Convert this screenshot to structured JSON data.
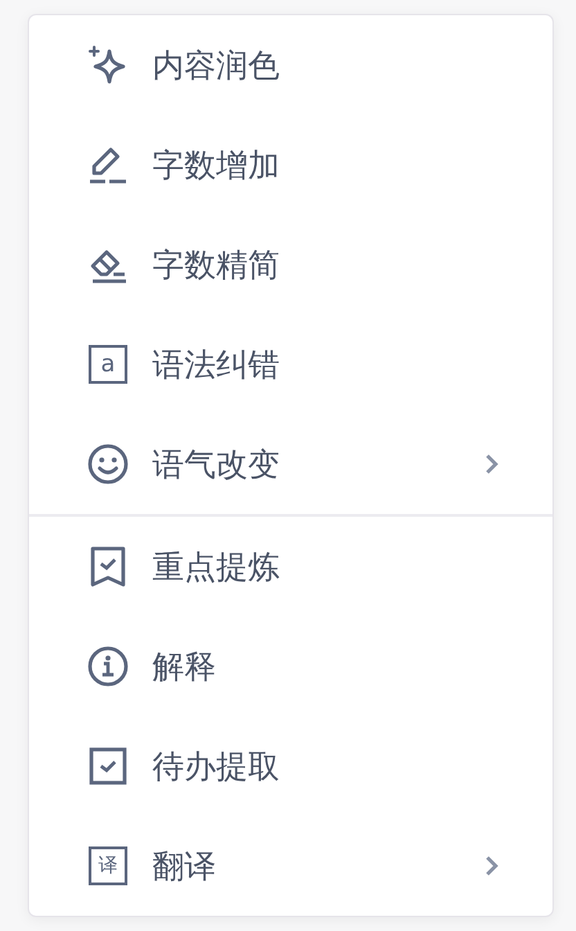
{
  "menu": {
    "sections": [
      {
        "items": [
          {
            "label": "内容润色",
            "kind": "sparkle",
            "has_submenu": false
          },
          {
            "label": "字数增加",
            "kind": "pencil",
            "has_submenu": false
          },
          {
            "label": "字数精简",
            "kind": "eraser",
            "has_submenu": false
          },
          {
            "label": "语法纠错",
            "kind": "letter",
            "icon_glyph": "a",
            "has_submenu": false
          },
          {
            "label": "语气改变",
            "kind": "smile",
            "has_submenu": true
          }
        ]
      },
      {
        "items": [
          {
            "label": "重点提炼",
            "kind": "bookmark",
            "has_submenu": false
          },
          {
            "label": "解释",
            "kind": "info",
            "has_submenu": false
          },
          {
            "label": "待办提取",
            "kind": "checkbox",
            "has_submenu": false
          },
          {
            "label": "翻译",
            "kind": "character",
            "icon_glyph": "译",
            "has_submenu": true
          }
        ]
      }
    ]
  }
}
